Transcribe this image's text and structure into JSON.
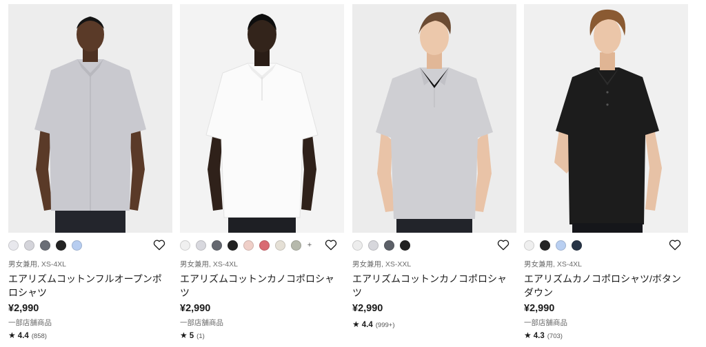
{
  "products": [
    {
      "image_alt": "Light gray full-open polo shirt",
      "swatches": [
        "#e8e8ed",
        "#d4d4da",
        "#6a6e76",
        "#232323",
        "#b7cdf0"
      ],
      "more": "",
      "meta": "男女兼用, XS-4XL",
      "name": "エアリズムコットンフルオープンポロシャツ",
      "price": "¥2,990",
      "note": "一部店舗商品",
      "rating": {
        "star": "★",
        "score": "4.4",
        "count": "(858)"
      }
    },
    {
      "image_alt": "White kanoko polo shirt",
      "swatches": [
        "#f0f0f0",
        "#d8d8de",
        "#656870",
        "#222222",
        "#efcfc8",
        "#d96a72",
        "#e5e0d6",
        "#b6b9ac"
      ],
      "more": "+",
      "meta": "男女兼用, XS-4XL",
      "name": "エアリズムコットンカノコポロシャツ",
      "price": "¥2,990",
      "note": "一部店舗商品",
      "rating": {
        "star": "★",
        "score": "5",
        "count": "(1)"
      }
    },
    {
      "image_alt": "Light gray kanoko polo shirt",
      "swatches": [
        "#ededed",
        "#d7d7dc",
        "#5c6068",
        "#222222"
      ],
      "more": "",
      "meta": "男女兼用, XS-XXL",
      "name": "エアリズムコットンカノコポロシャツ",
      "price": "¥2,990",
      "note": "",
      "rating": {
        "star": "★",
        "score": "4.4",
        "count": "(999+)"
      }
    },
    {
      "image_alt": "Black button-down kanoko polo shirt",
      "swatches": [
        "#efefef",
        "#262626",
        "#b9cff1",
        "#273446"
      ],
      "more": "",
      "meta": "男女兼用, XS-4XL",
      "name": "エアリズムカノコポロシャツ/ボタンダウン",
      "price": "¥2,990",
      "note": "一部店舗商品",
      "rating": {
        "star": "★",
        "score": "4.3",
        "count": "(703)"
      }
    }
  ]
}
